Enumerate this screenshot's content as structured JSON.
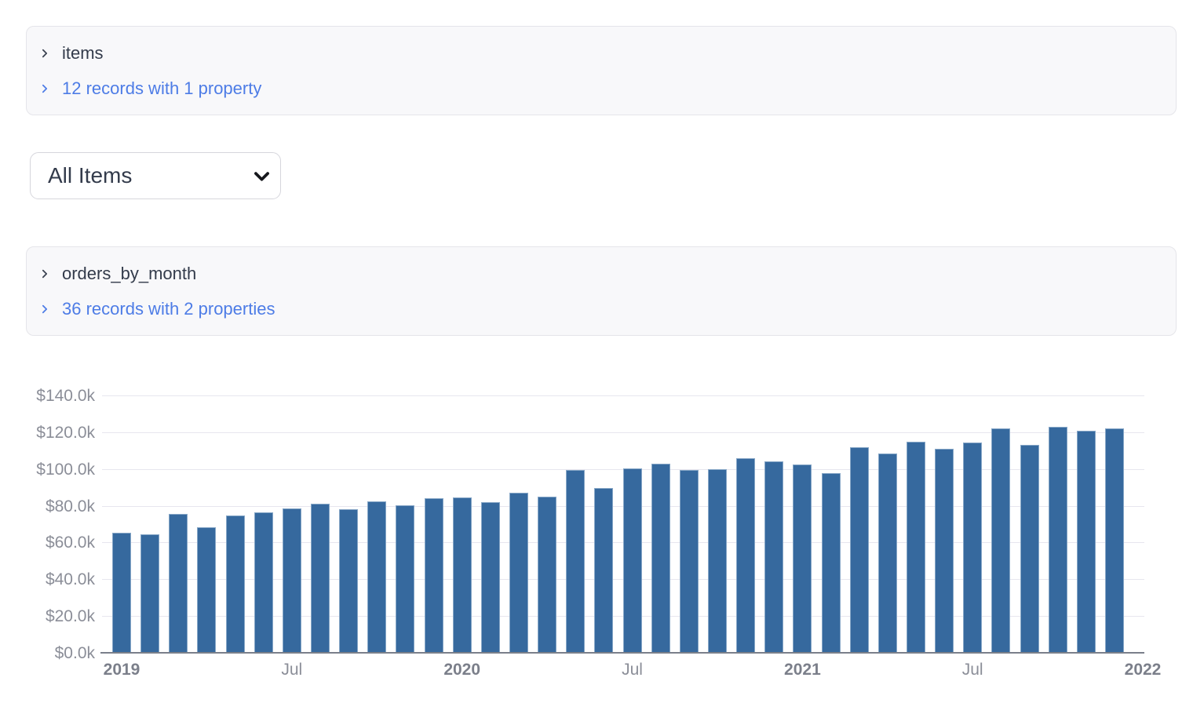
{
  "panels": [
    {
      "title": "items",
      "records_link": "12 records with 1 property"
    },
    {
      "title": "orders_by_month",
      "records_link": "36 records with 2 properties"
    }
  ],
  "dropdown": {
    "value": "All Items"
  },
  "chart_data": {
    "type": "bar",
    "x": [
      "2019-01",
      "2019-02",
      "2019-03",
      "2019-04",
      "2019-05",
      "2019-06",
      "2019-07",
      "2019-08",
      "2019-09",
      "2019-10",
      "2019-11",
      "2019-12",
      "2020-01",
      "2020-02",
      "2020-03",
      "2020-04",
      "2020-05",
      "2020-06",
      "2020-07",
      "2020-08",
      "2020-09",
      "2020-10",
      "2020-11",
      "2020-12",
      "2021-01",
      "2021-02",
      "2021-03",
      "2021-04",
      "2021-05",
      "2021-06",
      "2021-07",
      "2021-08",
      "2021-09",
      "2021-10",
      "2021-11",
      "2021-12"
    ],
    "values_usd_thousands": [
      65.5,
      64.5,
      75.6,
      68.5,
      74.8,
      76.6,
      78.7,
      81.3,
      78.2,
      82.4,
      80.2,
      84.1,
      84.4,
      81.9,
      87.3,
      85.1,
      99.5,
      89.8,
      100.3,
      102.9,
      99.3,
      100.1,
      105.7,
      104.0,
      102.5,
      97.6,
      111.9,
      108.6,
      115.0,
      111.0,
      114.3,
      122.1,
      113.3,
      123.1,
      120.7,
      122.1
    ],
    "ylim_thousands": [
      0,
      140
    ],
    "y_tick_values_thousands": [
      0,
      20,
      40,
      60,
      80,
      100,
      120,
      140
    ],
    "y_tick_labels": [
      "$0.0k",
      "$20.0k",
      "$40.0k",
      "$60.0k",
      "$80.0k",
      "$100.0k",
      "$120.0k",
      "$140.0k"
    ],
    "x_ticks": [
      {
        "month_index": 0,
        "label": "2019",
        "bold": true
      },
      {
        "month_index": 6,
        "label": "Jul",
        "bold": false
      },
      {
        "month_index": 12,
        "label": "2020",
        "bold": true
      },
      {
        "month_index": 18,
        "label": "Jul",
        "bold": false
      },
      {
        "month_index": 24,
        "label": "2021",
        "bold": true
      },
      {
        "month_index": 30,
        "label": "Jul",
        "bold": false
      },
      {
        "month_index": 36,
        "label": "2022",
        "bold": true
      }
    ],
    "grid": "horizontal",
    "legend": "none",
    "bar_color": "#36699e",
    "bar_stroke_color": "#87a7c7"
  },
  "colors": {
    "grid": "#e7e6ee",
    "axis": "#7a7f8a",
    "axis_text": "#8b8e98",
    "year_text": "#7b7f8a",
    "link": "#4d7ce6",
    "panel_bg": "#f8f8fa",
    "panel_border": "#e5e5ea",
    "text_dark": "#333b4b"
  }
}
